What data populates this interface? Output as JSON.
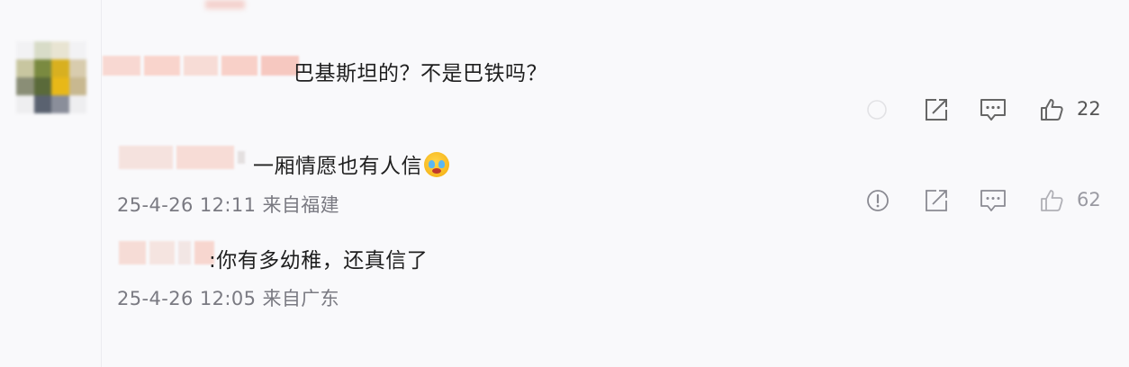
{
  "comment": {
    "text": "巴基斯坦的？不是巴铁吗？",
    "likes": "22"
  },
  "replies": [
    {
      "text": "一厢情愿也有人信",
      "emoji": "crying-face-emoji",
      "time": "25-4-26 12:11",
      "location": "来自福建",
      "likes": "62"
    },
    {
      "text": ":你有多幼稚，还真信了",
      "time": "25-4-26 12:05",
      "location": "来自广东"
    }
  ],
  "icons": [
    "report-icon",
    "share-icon",
    "reply-icon",
    "like-icon"
  ],
  "colors": {
    "background": "#f9f9fb",
    "meta_text": "#7a7a82",
    "icon": "#808088"
  }
}
